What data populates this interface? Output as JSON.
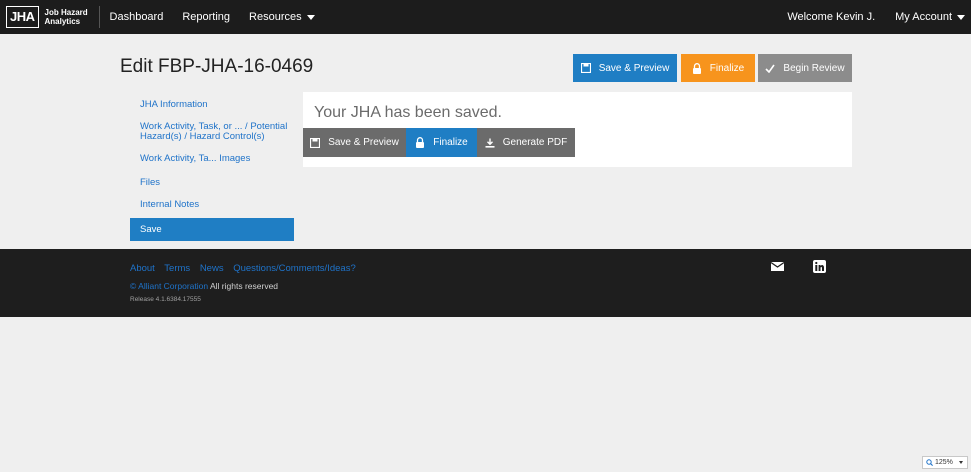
{
  "nav": {
    "logo_mark": "JHA",
    "logo_text_line1": "Job Hazard",
    "logo_text_line2": "Analytics",
    "items": [
      {
        "label": "Dashboard"
      },
      {
        "label": "Reporting"
      },
      {
        "label": "Resources"
      }
    ],
    "welcome": "Welcome Kevin J.",
    "account": "My Account"
  },
  "header": {
    "title": "Edit FBP-JHA-16-0469",
    "save_preview": "Save & Preview",
    "finalize": "Finalize",
    "begin_review": "Begin Review"
  },
  "sidebar": {
    "items": [
      {
        "label": "JHA Information"
      },
      {
        "label_line1": "Work Activity, Task, or ... / Potential",
        "label_line2": "Hazard(s) / Hazard Control(s)"
      },
      {
        "label": "Work Activity, Ta... Images"
      },
      {
        "label": "Files"
      },
      {
        "label": "Internal Notes"
      },
      {
        "label": "Save"
      }
    ]
  },
  "panel": {
    "message": "Your JHA has been saved.",
    "save_preview": "Save & Preview",
    "finalize": "Finalize",
    "generate_pdf": "Generate PDF"
  },
  "footer": {
    "links": [
      "About",
      "Terms",
      "News",
      "Questions/Comments/Ideas?"
    ],
    "copyright_brand": "© Alliant Corporation",
    "copyright_rest": "All rights reserved",
    "release": "Release 4.1.6384.17555"
  },
  "zoom": "125%",
  "colors": {
    "primary_blue": "#1f7ec4",
    "orange": "#f7941d",
    "gray": "#8c8c8c",
    "dark_gray": "#6b6b6b",
    "topbar": "#1c1c1c",
    "footer": "#1e1e1e"
  },
  "icons": {
    "save": "floppy-disk-icon",
    "finalize": "padlock-icon",
    "review": "checkmark-icon",
    "pdf": "download-icon",
    "email": "envelope-icon",
    "linkedin": "linkedin-icon",
    "zoom": "magnifier-icon"
  }
}
